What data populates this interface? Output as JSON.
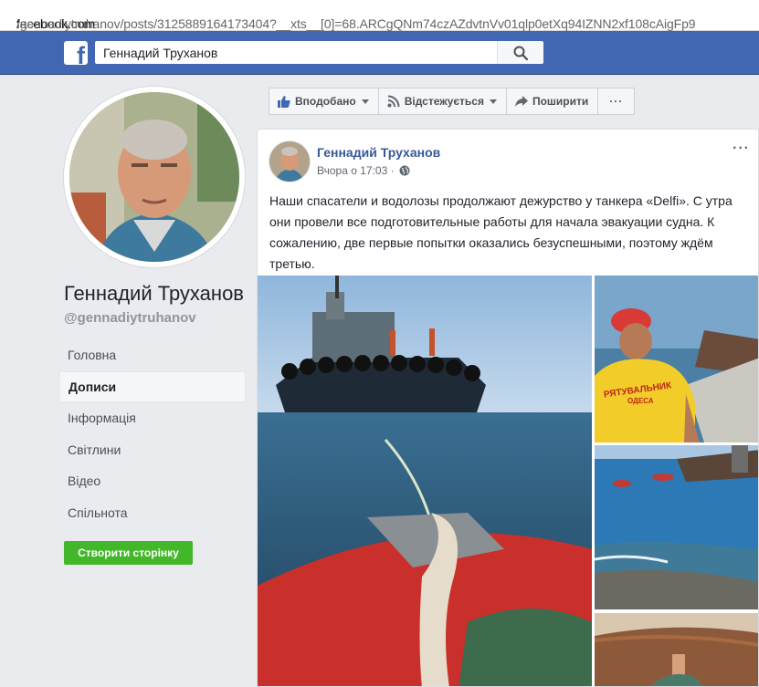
{
  "browser": {
    "url_host": "facebook.com",
    "url_rest": "/gennadiytruhanov/posts/3125889164173404?__xts__[0]=68.ARCgQNm74czAZdvtnVv01qlp0etXq94IZNN2xf108cAigFp9"
  },
  "topbar": {
    "search_value": "Геннадий Труханов",
    "logo_letter": "f",
    "brand_color": "#4267b2"
  },
  "profile": {
    "name": "Геннадий Труханов",
    "handle": "@gennadiytruhanov"
  },
  "nav": {
    "items": [
      {
        "label": "Головна",
        "active": false
      },
      {
        "label": "Дописи",
        "active": true
      },
      {
        "label": "Інформація",
        "active": false
      },
      {
        "label": "Світлини",
        "active": false
      },
      {
        "label": "Відео",
        "active": false
      },
      {
        "label": "Спільнота",
        "active": false
      }
    ],
    "create_page_label": "Створити сторінку"
  },
  "actions": {
    "liked_label": "Вподобано",
    "following_label": "Відстежується",
    "share_label": "Поширити",
    "more_label": "···"
  },
  "post": {
    "author": "Геннадий Труханов",
    "time": "Вчора о 17:03 ·",
    "audience_icon": "globe-icon",
    "menu_label": "···",
    "text": "Наши спасатели и водолозы продолжают дежурство у танкера «Delfi». С утра они провели все подготовительные работы для начала эвакуации судна. К сожалению, две первые попытки оказались безуспешными, поэтому ждём третью.",
    "photo_captions": {
      "shirt_text_1": "РЯТУВАЛЬНИК",
      "shirt_text_2": "ОДЕСА"
    }
  }
}
